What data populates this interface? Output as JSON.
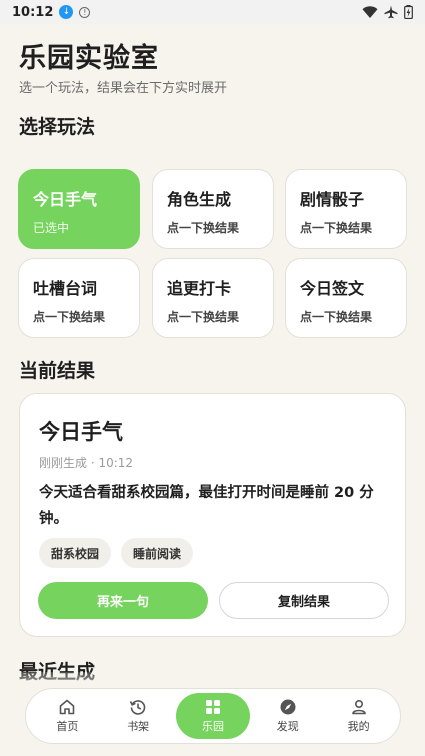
{
  "status": {
    "time": "10:12"
  },
  "header": {
    "title": "乐园实验室",
    "subtitle": "选一个玩法，结果会在下方实时展开"
  },
  "sections": {
    "choose": "选择玩法",
    "current": "当前结果",
    "recent": "最近生成"
  },
  "modes": [
    {
      "title": "今日手气",
      "sub": "已选中",
      "selected": true
    },
    {
      "title": "角色生成",
      "sub": "点一下换结果"
    },
    {
      "title": "剧情骰子",
      "sub": "点一下换结果"
    },
    {
      "title": "吐槽台词",
      "sub": "点一下换结果"
    },
    {
      "title": "追更打卡",
      "sub": "点一下换结果"
    },
    {
      "title": "今日签文",
      "sub": "点一下换结果"
    }
  ],
  "result": {
    "title": "今日手气",
    "meta": "刚刚生成 · 10:12",
    "body": "今天适合看甜系校园篇，最佳打开时间是睡前 20 分钟。",
    "tags": [
      "甜系校园",
      "睡前阅读"
    ],
    "primary_label": "再来一句",
    "secondary_label": "复制结果"
  },
  "nav": [
    {
      "label": "首页",
      "icon": "home-icon"
    },
    {
      "label": "书架",
      "icon": "history-icon"
    },
    {
      "label": "乐园",
      "icon": "grid-icon",
      "active": true
    },
    {
      "label": "发现",
      "icon": "compass-icon"
    },
    {
      "label": "我的",
      "icon": "person-icon"
    }
  ],
  "colors": {
    "accent": "#76d35d",
    "background": "#f7f4ee"
  }
}
